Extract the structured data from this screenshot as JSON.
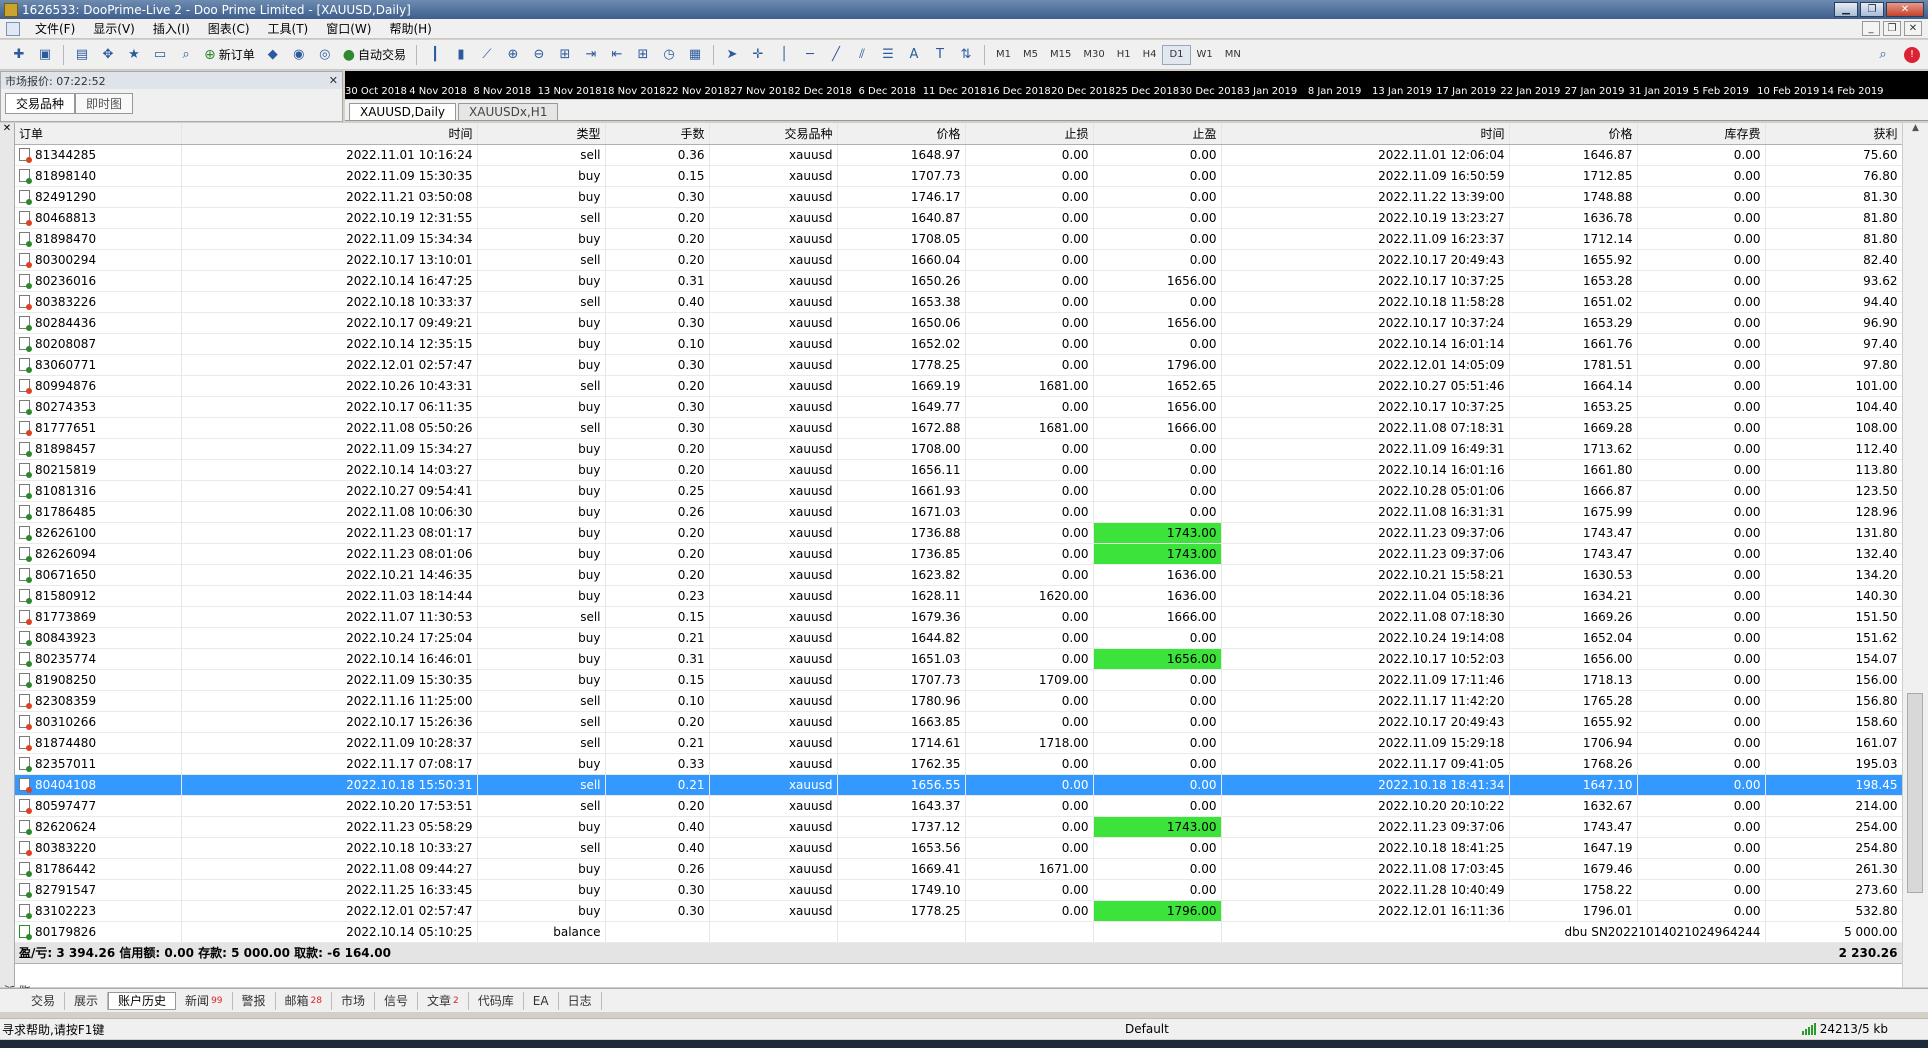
{
  "window": {
    "title": "1626533: DooPrime-Live 2 - Doo Prime Limited - [XAUUSD,Daily]"
  },
  "menu": [
    "文件(F)",
    "显示(V)",
    "插入(I)",
    "图表(C)",
    "工具(T)",
    "窗口(W)",
    "帮助(H)"
  ],
  "toolbar": {
    "new_order": "新订单",
    "auto_trade": "自动交易",
    "periods": [
      "M1",
      "M5",
      "M15",
      "M30",
      "H1",
      "H4",
      "D1",
      "W1",
      "MN"
    ],
    "active_period": "D1"
  },
  "market_watch": {
    "title": "市场报价: 07:22:52",
    "tab_symbols": "交易品种",
    "tab_ticks": "即时图"
  },
  "chart": {
    "dates": [
      "30 Oct 2018",
      "4 Nov 2018",
      "8 Nov 2018",
      "13 Nov 2018",
      "18 Nov 2018",
      "22 Nov 2018",
      "27 Nov 2018",
      "2 Dec 2018",
      "6 Dec 2018",
      "11 Dec 2018",
      "16 Dec 2018",
      "20 Dec 2018",
      "25 Dec 2018",
      "30 Dec 2018",
      "3 Jan 2019",
      "8 Jan 2019",
      "13 Jan 2019",
      "17 Jan 2019",
      "22 Jan 2019",
      "27 Jan 2019",
      "31 Jan 2019",
      "5 Feb 2019",
      "10 Feb 2019",
      "14 Feb 2019"
    ],
    "tabs": [
      "XAUUSD,Daily",
      "XAUUSDx,H1"
    ]
  },
  "table": {
    "headers": [
      "订单",
      "时间",
      "类型",
      "手数",
      "交易品种",
      "价格",
      "止损",
      "止盈",
      "时间",
      "价格",
      "库存费",
      "获利"
    ],
    "rows": [
      [
        "81344285",
        "2022.11.01 10:16:24",
        "sell",
        "0.36",
        "xauusd",
        "1648.97",
        "0.00",
        "0.00",
        "2022.11.01 12:06:04",
        "1646.87",
        "0.00",
        "75.60"
      ],
      [
        "81898140",
        "2022.11.09 15:30:35",
        "buy",
        "0.15",
        "xauusd",
        "1707.73",
        "0.00",
        "0.00",
        "2022.11.09 16:50:59",
        "1712.85",
        "0.00",
        "76.80"
      ],
      [
        "82491290",
        "2022.11.21 03:50:08",
        "buy",
        "0.30",
        "xauusd",
        "1746.17",
        "0.00",
        "0.00",
        "2022.11.22 13:39:00",
        "1748.88",
        "0.00",
        "81.30"
      ],
      [
        "80468813",
        "2022.10.19 12:31:55",
        "sell",
        "0.20",
        "xauusd",
        "1640.87",
        "0.00",
        "0.00",
        "2022.10.19 13:23:27",
        "1636.78",
        "0.00",
        "81.80"
      ],
      [
        "81898470",
        "2022.11.09 15:34:34",
        "buy",
        "0.20",
        "xauusd",
        "1708.05",
        "0.00",
        "0.00",
        "2022.11.09 16:23:37",
        "1712.14",
        "0.00",
        "81.80"
      ],
      [
        "80300294",
        "2022.10.17 13:10:01",
        "sell",
        "0.20",
        "xauusd",
        "1660.04",
        "0.00",
        "0.00",
        "2022.10.17 20:49:43",
        "1655.92",
        "0.00",
        "82.40"
      ],
      [
        "80236016",
        "2022.10.14 16:47:25",
        "buy",
        "0.31",
        "xauusd",
        "1650.26",
        "0.00",
        "1656.00",
        "2022.10.17 10:37:25",
        "1653.28",
        "0.00",
        "93.62"
      ],
      [
        "80383226",
        "2022.10.18 10:33:37",
        "sell",
        "0.40",
        "xauusd",
        "1653.38",
        "0.00",
        "0.00",
        "2022.10.18 11:58:28",
        "1651.02",
        "0.00",
        "94.40"
      ],
      [
        "80284436",
        "2022.10.17 09:49:21",
        "buy",
        "0.30",
        "xauusd",
        "1650.06",
        "0.00",
        "1656.00",
        "2022.10.17 10:37:24",
        "1653.29",
        "0.00",
        "96.90"
      ],
      [
        "80208087",
        "2022.10.14 12:35:15",
        "buy",
        "0.10",
        "xauusd",
        "1652.02",
        "0.00",
        "0.00",
        "2022.10.14 16:01:14",
        "1661.76",
        "0.00",
        "97.40"
      ],
      [
        "83060771",
        "2022.12.01 02:57:47",
        "buy",
        "0.30",
        "xauusd",
        "1778.25",
        "0.00",
        "1796.00",
        "2022.12.01 14:05:09",
        "1781.51",
        "0.00",
        "97.80"
      ],
      [
        "80994876",
        "2022.10.26 10:43:31",
        "sell",
        "0.20",
        "xauusd",
        "1669.19",
        "1681.00",
        "1652.65",
        "2022.10.27 05:51:46",
        "1664.14",
        "0.00",
        "101.00"
      ],
      [
        "80274353",
        "2022.10.17 06:11:35",
        "buy",
        "0.30",
        "xauusd",
        "1649.77",
        "0.00",
        "1656.00",
        "2022.10.17 10:37:25",
        "1653.25",
        "0.00",
        "104.40"
      ],
      [
        "81777651",
        "2022.11.08 05:50:26",
        "sell",
        "0.30",
        "xauusd",
        "1672.88",
        "1681.00",
        "1666.00",
        "2022.11.08 07:18:31",
        "1669.28",
        "0.00",
        "108.00"
      ],
      [
        "81898457",
        "2022.11.09 15:34:27",
        "buy",
        "0.20",
        "xauusd",
        "1708.00",
        "0.00",
        "0.00",
        "2022.11.09 16:49:31",
        "1713.62",
        "0.00",
        "112.40"
      ],
      [
        "80215819",
        "2022.10.14 14:03:27",
        "buy",
        "0.20",
        "xauusd",
        "1656.11",
        "0.00",
        "0.00",
        "2022.10.14 16:01:16",
        "1661.80",
        "0.00",
        "113.80"
      ],
      [
        "81081316",
        "2022.10.27 09:54:41",
        "buy",
        "0.25",
        "xauusd",
        "1661.93",
        "0.00",
        "0.00",
        "2022.10.28 05:01:06",
        "1666.87",
        "0.00",
        "123.50"
      ],
      [
        "81786485",
        "2022.11.08 10:06:30",
        "buy",
        "0.26",
        "xauusd",
        "1671.03",
        "0.00",
        "0.00",
        "2022.11.08 16:31:31",
        "1675.99",
        "0.00",
        "128.96"
      ],
      [
        "82626100",
        "2022.11.23 08:01:17",
        "buy",
        "0.20",
        "xauusd",
        "1736.88",
        "0.00",
        "1743.00",
        "2022.11.23 09:37:06",
        "1743.47",
        "0.00",
        "131.80"
      ],
      [
        "82626094",
        "2022.11.23 08:01:06",
        "buy",
        "0.20",
        "xauusd",
        "1736.85",
        "0.00",
        "1743.00",
        "2022.11.23 09:37:06",
        "1743.47",
        "0.00",
        "132.40"
      ],
      [
        "80671650",
        "2022.10.21 14:46:35",
        "buy",
        "0.20",
        "xauusd",
        "1623.82",
        "0.00",
        "1636.00",
        "2022.10.21 15:58:21",
        "1630.53",
        "0.00",
        "134.20"
      ],
      [
        "81580912",
        "2022.11.03 18:14:44",
        "buy",
        "0.23",
        "xauusd",
        "1628.11",
        "1620.00",
        "1636.00",
        "2022.11.04 05:18:36",
        "1634.21",
        "0.00",
        "140.30"
      ],
      [
        "81773869",
        "2022.11.07 11:30:53",
        "sell",
        "0.15",
        "xauusd",
        "1679.36",
        "0.00",
        "1666.00",
        "2022.11.08 07:18:30",
        "1669.26",
        "0.00",
        "151.50"
      ],
      [
        "80843923",
        "2022.10.24 17:25:04",
        "buy",
        "0.21",
        "xauusd",
        "1644.82",
        "0.00",
        "0.00",
        "2022.10.24 19:14:08",
        "1652.04",
        "0.00",
        "151.62"
      ],
      [
        "80235774",
        "2022.10.14 16:46:01",
        "buy",
        "0.31",
        "xauusd",
        "1651.03",
        "0.00",
        "1656.00",
        "2022.10.17 10:52:03",
        "1656.00",
        "0.00",
        "154.07"
      ],
      [
        "81908250",
        "2022.11.09 15:30:35",
        "buy",
        "0.15",
        "xauusd",
        "1707.73",
        "1709.00",
        "0.00",
        "2022.11.09 17:11:46",
        "1718.13",
        "0.00",
        "156.00"
      ],
      [
        "82308359",
        "2022.11.16 11:25:00",
        "sell",
        "0.10",
        "xauusd",
        "1780.96",
        "0.00",
        "0.00",
        "2022.11.17 11:42:20",
        "1765.28",
        "0.00",
        "156.80"
      ],
      [
        "80310266",
        "2022.10.17 15:26:36",
        "sell",
        "0.20",
        "xauusd",
        "1663.85",
        "0.00",
        "0.00",
        "2022.10.17 20:49:43",
        "1655.92",
        "0.00",
        "158.60"
      ],
      [
        "81874480",
        "2022.11.09 10:28:37",
        "sell",
        "0.21",
        "xauusd",
        "1714.61",
        "1718.00",
        "0.00",
        "2022.11.09 15:29:18",
        "1706.94",
        "0.00",
        "161.07"
      ],
      [
        "82357011",
        "2022.11.17 07:08:17",
        "buy",
        "0.33",
        "xauusd",
        "1762.35",
        "0.00",
        "0.00",
        "2022.11.17 09:41:05",
        "1768.26",
        "0.00",
        "195.03"
      ],
      [
        "80404108",
        "2022.10.18 15:50:31",
        "sell",
        "0.21",
        "xauusd",
        "1656.55",
        "0.00",
        "0.00",
        "2022.10.18 18:41:34",
        "1647.10",
        "0.00",
        "198.45"
      ],
      [
        "80597477",
        "2022.10.20 17:53:51",
        "sell",
        "0.20",
        "xauusd",
        "1643.37",
        "0.00",
        "0.00",
        "2022.10.20 20:10:22",
        "1632.67",
        "0.00",
        "214.00"
      ],
      [
        "82620624",
        "2022.11.23 05:58:29",
        "buy",
        "0.40",
        "xauusd",
        "1737.12",
        "0.00",
        "1743.00",
        "2022.11.23 09:37:06",
        "1743.47",
        "0.00",
        "254.00"
      ],
      [
        "80383220",
        "2022.10.18 10:33:27",
        "sell",
        "0.40",
        "xauusd",
        "1653.56",
        "0.00",
        "0.00",
        "2022.10.18 18:41:25",
        "1647.19",
        "0.00",
        "254.80"
      ],
      [
        "81786442",
        "2022.11.08 09:44:27",
        "buy",
        "0.26",
        "xauusd",
        "1669.41",
        "1671.00",
        "0.00",
        "2022.11.08 17:03:45",
        "1679.46",
        "0.00",
        "261.30"
      ],
      [
        "82791547",
        "2022.11.25 16:33:45",
        "buy",
        "0.30",
        "xauusd",
        "1749.10",
        "0.00",
        "0.00",
        "2022.11.28 10:40:49",
        "1758.22",
        "0.00",
        "273.60"
      ],
      [
        "83102223",
        "2022.12.01 02:57:47",
        "buy",
        "0.30",
        "xauusd",
        "1778.25",
        "0.00",
        "1796.00",
        "2022.12.01 16:11:36",
        "1796.01",
        "0.00",
        "532.80"
      ]
    ],
    "highlighted_order": "80404108",
    "green_tp_orders": [
      "82626100",
      "82626094",
      "80235774",
      "82620624",
      "83102223"
    ],
    "balance_row": {
      "order": "80179826",
      "time": "2022.10.14 05:10:25",
      "type": "balance",
      "comment": "dbu SN20221014021024964244",
      "amount": "5 000.00"
    },
    "summary": {
      "text": "盈/亏: 3 394.26  信用额: 0.00  存款: 5 000.00  取款: -6 164.00",
      "total": "2 230.26"
    }
  },
  "bottom_tabs": [
    {
      "label": "交易",
      "badge": ""
    },
    {
      "label": "展示",
      "badge": ""
    },
    {
      "label": "账户历史",
      "badge": "",
      "active": true
    },
    {
      "label": "新闻",
      "badge": "99"
    },
    {
      "label": "警报",
      "badge": ""
    },
    {
      "label": "邮箱",
      "badge": "28"
    },
    {
      "label": "市场",
      "badge": ""
    },
    {
      "label": "信号",
      "badge": ""
    },
    {
      "label": "文章",
      "badge": "2"
    },
    {
      "label": "代码库",
      "badge": ""
    },
    {
      "label": "EA",
      "badge": ""
    },
    {
      "label": "日志",
      "badge": ""
    }
  ],
  "side_label": "终端",
  "status": {
    "help": "寻求帮助,请按F1键",
    "profile": "Default",
    "connection": "24213/5 kb"
  }
}
